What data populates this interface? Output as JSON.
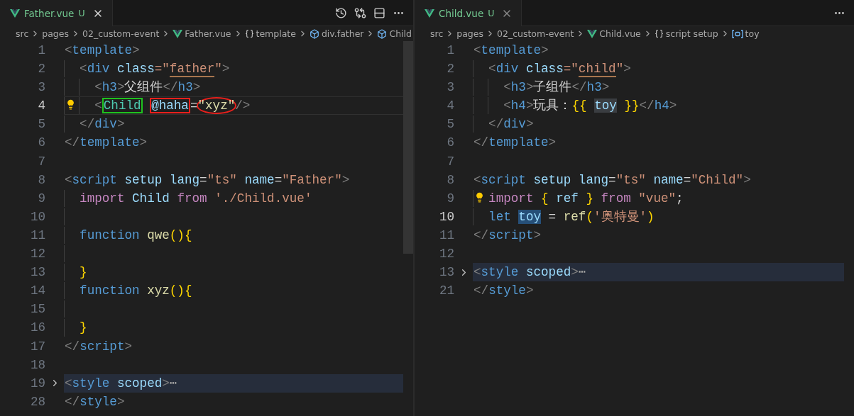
{
  "editors": [
    {
      "focused": true,
      "tab": {
        "label": "Father.vue",
        "status": "U"
      },
      "actions": [
        {
          "kind": "history"
        },
        {
          "kind": "compare"
        },
        {
          "kind": "split"
        },
        {
          "kind": "more"
        }
      ],
      "breadcrumbs": [
        {
          "label": "src",
          "kind": "none"
        },
        {
          "label": "pages",
          "kind": "none"
        },
        {
          "label": "02_custom-event",
          "kind": "none"
        },
        {
          "label": "Father.vue",
          "kind": "vue"
        },
        {
          "label": "template",
          "kind": "braces"
        },
        {
          "label": "div.father",
          "kind": "cube"
        },
        {
          "label": "Child",
          "kind": "cube"
        }
      ],
      "lines": [
        {
          "n": "1",
          "current": false,
          "folded": false,
          "lightbulb": false,
          "tokens": [
            {
              "text": "<",
              "kind": "p"
            },
            {
              "text": "template",
              "kind": "tag"
            },
            {
              "text": ">",
              "kind": "p"
            }
          ],
          "children": [
            {
              "n": "2",
              "current": false,
              "folded": false,
              "lightbulb": false,
              "tokens": [
                {
                  "text": "<",
                  "kind": "p"
                },
                {
                  "text": "div",
                  "kind": "tag"
                },
                {
                  "text": " class",
                  "kind": "attr"
                },
                {
                  "text": "=\"",
                  "kind": "str"
                },
                {
                  "text": "father",
                  "kind": "str",
                  "decoration": {
                    "kind": "underline"
                  }
                },
                {
                  "text": "\"",
                  "kind": "str"
                },
                {
                  "text": ">",
                  "kind": "p"
                }
              ],
              "children": [
                {
                  "n": "3",
                  "current": false,
                  "folded": false,
                  "lightbulb": false,
                  "tokens": [
                    {
                      "text": "<",
                      "kind": "p"
                    },
                    {
                      "text": "h3",
                      "kind": "tag"
                    },
                    {
                      "text": ">",
                      "kind": "p"
                    },
                    {
                      "text": "父组件",
                      "kind": "plain"
                    },
                    {
                      "text": "</",
                      "kind": "p"
                    },
                    {
                      "text": "h3",
                      "kind": "tag"
                    },
                    {
                      "text": ">",
                      "kind": "p"
                    }
                  ]
                },
                {
                  "n": "4",
                  "current": true,
                  "folded": false,
                  "lightbulb": true,
                  "tokens": [
                    {
                      "text": "<",
                      "kind": "p"
                    },
                    {
                      "text": "Child",
                      "kind": "comp",
                      "decoration": {
                        "kind": "box",
                        "color": "#1fc21f"
                      }
                    },
                    {
                      "text": " @haha",
                      "kind": "attr",
                      "decoration": {
                        "kind": "box",
                        "color": "#e8201c"
                      }
                    },
                    {
                      "text": "=",
                      "kind": "plain"
                    },
                    {
                      "text": "\"xyz\"",
                      "kind": "func",
                      "decoration": {
                        "kind": "circle",
                        "color": "#e8201c"
                      }
                    },
                    {
                      "text": "/>",
                      "kind": "p"
                    }
                  ]
                }
              ]
            },
            {
              "n": "5",
              "current": false,
              "folded": false,
              "lightbulb": false,
              "tokens": [
                {
                  "text": "</",
                  "kind": "p"
                },
                {
                  "text": "div",
                  "kind": "tag"
                },
                {
                  "text": ">",
                  "kind": "p"
                }
              ]
            }
          ]
        },
        {
          "n": "6",
          "current": false,
          "folded": false,
          "lightbulb": false,
          "tokens": [
            {
              "text": "</",
              "kind": "p"
            },
            {
              "text": "template",
              "kind": "tag"
            },
            {
              "text": ">",
              "kind": "p"
            }
          ]
        },
        {
          "n": "7",
          "current": false,
          "folded": false,
          "lightbulb": false
        },
        {
          "n": "8",
          "current": false,
          "folded": false,
          "lightbulb": false,
          "tokens": [
            {
              "text": "<",
              "kind": "p"
            },
            {
              "text": "script",
              "kind": "tag"
            },
            {
              "text": " setup",
              "kind": "attr"
            },
            {
              "text": " lang",
              "kind": "attr"
            },
            {
              "text": "=",
              "kind": "plain"
            },
            {
              "text": "\"ts\"",
              "kind": "str"
            },
            {
              "text": " name",
              "kind": "attr"
            },
            {
              "text": "=",
              "kind": "plain"
            },
            {
              "text": "\"Father\"",
              "kind": "str"
            },
            {
              "text": ">",
              "kind": "p"
            }
          ],
          "children": [
            {
              "n": "9",
              "current": false,
              "folded": false,
              "lightbulb": false,
              "tokens": [
                {
                  "text": "import",
                  "kind": "kw"
                },
                {
                  "text": " Child",
                  "kind": "var"
                },
                {
                  "text": " from",
                  "kind": "kw"
                },
                {
                  "text": " './Child.vue'",
                  "kind": "str"
                }
              ]
            },
            {
              "n": "10",
              "current": false,
              "folded": false,
              "lightbulb": false
            },
            {
              "n": "11",
              "current": false,
              "folded": false,
              "lightbulb": false,
              "tokens": [
                {
                  "text": "function",
                  "kind": "fn"
                },
                {
                  "text": " qwe",
                  "kind": "func"
                },
                {
                  "text": "(){",
                  "kind": "brace"
                }
              ]
            },
            {
              "n": "12",
              "current": false,
              "folded": false,
              "lightbulb": false
            },
            {
              "n": "13",
              "current": false,
              "folded": false,
              "lightbulb": false,
              "tokens": [
                {
                  "text": "}",
                  "kind": "brace"
                }
              ]
            },
            {
              "n": "14",
              "current": false,
              "folded": false,
              "lightbulb": false,
              "tokens": [
                {
                  "text": "function",
                  "kind": "fn"
                },
                {
                  "text": " xyz",
                  "kind": "func"
                },
                {
                  "text": "(){",
                  "kind": "brace"
                }
              ]
            },
            {
              "n": "15",
              "current": false,
              "folded": false,
              "lightbulb": false
            },
            {
              "n": "16",
              "current": false,
              "folded": false,
              "lightbulb": false,
              "tokens": [
                {
                  "text": "}",
                  "kind": "brace"
                }
              ]
            }
          ]
        },
        {
          "n": "17",
          "current": false,
          "folded": false,
          "lightbulb": false,
          "tokens": [
            {
              "text": "</",
              "kind": "p"
            },
            {
              "text": "script",
              "kind": "tag"
            },
            {
              "text": ">",
              "kind": "p"
            }
          ]
        },
        {
          "n": "18",
          "current": false,
          "folded": false,
          "lightbulb": false
        },
        {
          "n": "19",
          "current": false,
          "folded": true,
          "lightbulb": false,
          "tokens": [
            {
              "text": "<",
              "kind": "p"
            },
            {
              "text": "style",
              "kind": "tag"
            },
            {
              "text": " scoped",
              "kind": "attr"
            },
            {
              "text": ">",
              "kind": "p"
            },
            {
              "text": "⋯",
              "kind": "ell"
            }
          ]
        },
        {
          "n": "28",
          "current": false,
          "folded": false,
          "lightbulb": false,
          "tokens": [
            {
              "text": "</",
              "kind": "p"
            },
            {
              "text": "style",
              "kind": "tag"
            },
            {
              "text": ">",
              "kind": "p"
            }
          ]
        }
      ]
    },
    {
      "focused": false,
      "tab": {
        "label": "Child.vue",
        "status": "U"
      },
      "actions": [
        {
          "kind": "more"
        }
      ],
      "breadcrumbs": [
        {
          "label": "src",
          "kind": "none"
        },
        {
          "label": "pages",
          "kind": "none"
        },
        {
          "label": "02_custom-event",
          "kind": "none"
        },
        {
          "label": "Child.vue",
          "kind": "vue"
        },
        {
          "label": "script setup",
          "kind": "braces"
        },
        {
          "label": "toy",
          "kind": "variable"
        }
      ],
      "lines": [
        {
          "n": "1",
          "current": false,
          "folded": false,
          "lightbulb": false,
          "tokens": [
            {
              "text": "<",
              "kind": "p"
            },
            {
              "text": "template",
              "kind": "tag"
            },
            {
              "text": ">",
              "kind": "p"
            }
          ],
          "children": [
            {
              "n": "2",
              "current": false,
              "folded": false,
              "lightbulb": false,
              "tokens": [
                {
                  "text": "<",
                  "kind": "p"
                },
                {
                  "text": "div",
                  "kind": "tag"
                },
                {
                  "text": " class",
                  "kind": "attr"
                },
                {
                  "text": "=\"",
                  "kind": "str"
                },
                {
                  "text": "child",
                  "kind": "str",
                  "decoration": {
                    "kind": "underline"
                  }
                },
                {
                  "text": "\"",
                  "kind": "str"
                },
                {
                  "text": ">",
                  "kind": "p"
                }
              ],
              "children": [
                {
                  "n": "3",
                  "current": false,
                  "folded": false,
                  "lightbulb": false,
                  "tokens": [
                    {
                      "text": "<",
                      "kind": "p"
                    },
                    {
                      "text": "h3",
                      "kind": "tag"
                    },
                    {
                      "text": ">",
                      "kind": "p"
                    },
                    {
                      "text": "子组件",
                      "kind": "plain"
                    },
                    {
                      "text": "</",
                      "kind": "p"
                    },
                    {
                      "text": "h3",
                      "kind": "tag"
                    },
                    {
                      "text": ">",
                      "kind": "p"
                    }
                  ]
                },
                {
                  "n": "4",
                  "current": false,
                  "folded": false,
                  "lightbulb": false,
                  "tokens": [
                    {
                      "text": "<",
                      "kind": "p"
                    },
                    {
                      "text": "h4",
                      "kind": "tag"
                    },
                    {
                      "text": ">",
                      "kind": "p"
                    },
                    {
                      "text": "玩具：",
                      "kind": "plain"
                    },
                    {
                      "text": "{{ ",
                      "kind": "brace"
                    },
                    {
                      "text": "toy",
                      "kind": "var",
                      "decoration": {
                        "kind": "occurrence"
                      }
                    },
                    {
                      "text": " }}",
                      "kind": "brace"
                    },
                    {
                      "text": "</",
                      "kind": "p"
                    },
                    {
                      "text": "h4",
                      "kind": "tag"
                    },
                    {
                      "text": ">",
                      "kind": "p"
                    }
                  ]
                }
              ]
            },
            {
              "n": "5",
              "current": false,
              "folded": false,
              "lightbulb": false,
              "tokens": [
                {
                  "text": "</",
                  "kind": "p"
                },
                {
                  "text": "div",
                  "kind": "tag"
                },
                {
                  "text": ">",
                  "kind": "p"
                }
              ]
            }
          ]
        },
        {
          "n": "6",
          "current": false,
          "folded": false,
          "lightbulb": false,
          "tokens": [
            {
              "text": "</",
              "kind": "p"
            },
            {
              "text": "template",
              "kind": "tag"
            },
            {
              "text": ">",
              "kind": "p"
            }
          ]
        },
        {
          "n": "7",
          "current": false,
          "folded": false,
          "lightbulb": false
        },
        {
          "n": "8",
          "current": false,
          "folded": false,
          "lightbulb": false,
          "tokens": [
            {
              "text": "<",
              "kind": "p"
            },
            {
              "text": "script",
              "kind": "tag"
            },
            {
              "text": " setup",
              "kind": "attr"
            },
            {
              "text": " lang",
              "kind": "attr"
            },
            {
              "text": "=",
              "kind": "plain"
            },
            {
              "text": "\"ts\"",
              "kind": "str"
            },
            {
              "text": " name",
              "kind": "attr"
            },
            {
              "text": "=",
              "kind": "plain"
            },
            {
              "text": "\"Child\"",
              "kind": "str"
            },
            {
              "text": ">",
              "kind": "p"
            }
          ],
          "children": [
            {
              "n": "9",
              "current": false,
              "folded": false,
              "lightbulb": true,
              "tokens": [
                {
                  "text": "import",
                  "kind": "kw"
                },
                {
                  "text": " {",
                  "kind": "brace"
                },
                {
                  "text": " ref",
                  "kind": "var"
                },
                {
                  "text": " }",
                  "kind": "brace"
                },
                {
                  "text": " from",
                  "kind": "kw"
                },
                {
                  "text": " \"vue\"",
                  "kind": "str"
                },
                {
                  "text": ";",
                  "kind": "plain"
                }
              ]
            },
            {
              "n": "10",
              "current": true,
              "folded": false,
              "lightbulb": false,
              "tokens": [
                {
                  "text": "let ",
                  "kind": "fn"
                },
                {
                  "text": "toy",
                  "kind": "var",
                  "decoration": {
                    "kind": "selection"
                  }
                },
                {
                  "text": " =",
                  "kind": "plain"
                },
                {
                  "text": " ref",
                  "kind": "func"
                },
                {
                  "text": "(",
                  "kind": "brace"
                },
                {
                  "text": "'奥特曼'",
                  "kind": "str"
                },
                {
                  "text": ")",
                  "kind": "brace"
                }
              ]
            }
          ]
        },
        {
          "n": "11",
          "current": false,
          "folded": false,
          "lightbulb": false,
          "tokens": [
            {
              "text": "</",
              "kind": "p"
            },
            {
              "text": "script",
              "kind": "tag"
            },
            {
              "text": ">",
              "kind": "p"
            }
          ]
        },
        {
          "n": "12",
          "current": false,
          "folded": false,
          "lightbulb": false
        },
        {
          "n": "13",
          "current": false,
          "folded": true,
          "lightbulb": false,
          "tokens": [
            {
              "text": "<",
              "kind": "p"
            },
            {
              "text": "style",
              "kind": "tag"
            },
            {
              "text": " scoped",
              "kind": "attr"
            },
            {
              "text": ">",
              "kind": "p"
            },
            {
              "text": "⋯",
              "kind": "ell"
            }
          ]
        },
        {
          "n": "21",
          "current": false,
          "folded": false,
          "lightbulb": false,
          "tokens": [
            {
              "text": "</",
              "kind": "p"
            },
            {
              "text": "style",
              "kind": "tag"
            },
            {
              "text": ">",
              "kind": "p"
            }
          ]
        }
      ]
    }
  ]
}
